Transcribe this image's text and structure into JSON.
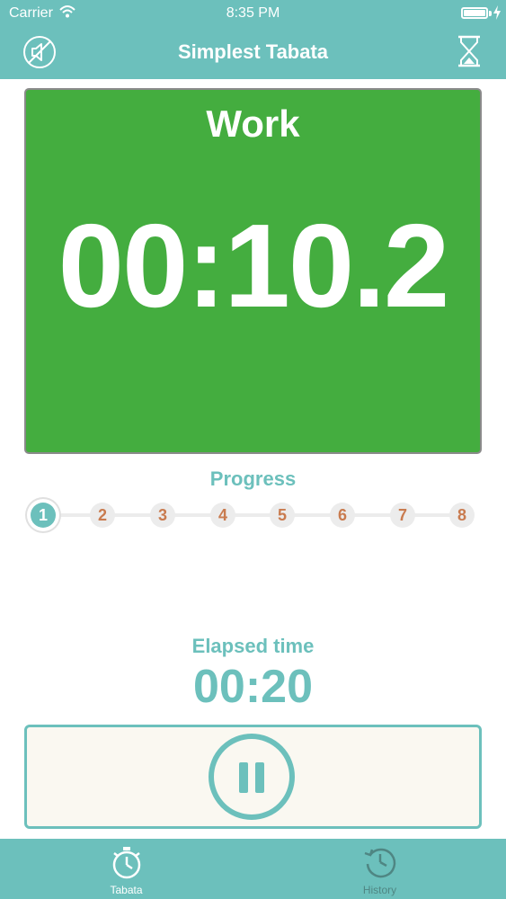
{
  "status": {
    "carrier": "Carrier",
    "time": "8:35 PM"
  },
  "nav": {
    "title": "Simplest Tabata",
    "left_icon": "mute-icon",
    "right_icon": "hourglass-icon"
  },
  "work": {
    "phase": "Work",
    "countdown": "00:10.2",
    "color": "#44ad3f"
  },
  "progress": {
    "label": "Progress",
    "current": 1,
    "steps": [
      "1",
      "2",
      "3",
      "4",
      "5",
      "6",
      "7",
      "8"
    ]
  },
  "elapsed": {
    "label": "Elapsed time",
    "value": "00:20"
  },
  "controls": {
    "icon": "pause-icon"
  },
  "tabs": [
    {
      "label": "Tabata",
      "icon": "stopwatch-icon",
      "selected": true
    },
    {
      "label": "History",
      "icon": "history-icon",
      "selected": false
    }
  ],
  "colors": {
    "accent": "#6cc0bc",
    "step_text": "#c97b4f",
    "panel_bg": "#faf8f1"
  }
}
